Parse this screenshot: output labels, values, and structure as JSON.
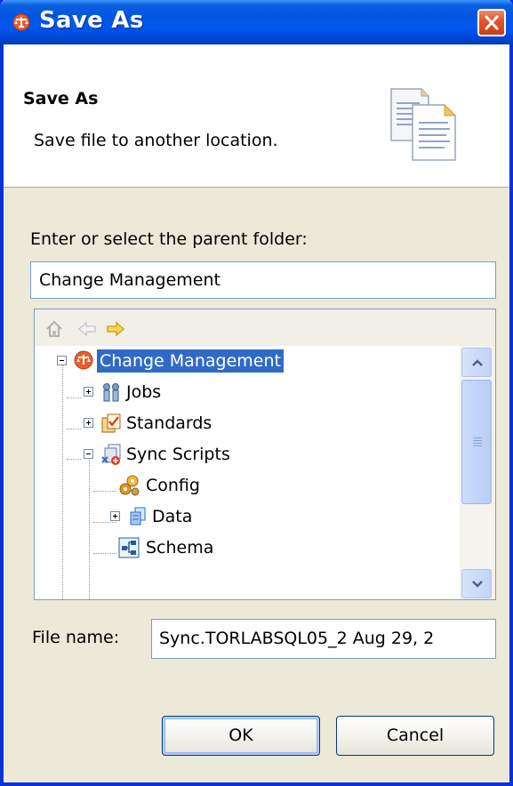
{
  "window": {
    "title": "Save As"
  },
  "banner": {
    "title": "Save As",
    "description": "Save file to another location."
  },
  "form": {
    "parent_label": "Enter or select the parent folder:",
    "parent_value": "Change Management",
    "filename_label": "File name:",
    "filename_value": "Sync.TORLABSQL05_2 Aug 29, 2"
  },
  "tree": {
    "items": [
      {
        "label": "Change Management",
        "level": 0,
        "expander": "minus",
        "selected": true,
        "icon": "project-icon"
      },
      {
        "label": "Jobs",
        "level": 1,
        "expander": "plus",
        "icon": "jobs-icon"
      },
      {
        "label": "Standards",
        "level": 1,
        "expander": "plus",
        "icon": "standards-icon"
      },
      {
        "label": "Sync Scripts",
        "level": 1,
        "expander": "minus",
        "icon": "sync-scripts-icon"
      },
      {
        "label": "Config",
        "level": 2,
        "expander": "none",
        "icon": "config-icon"
      },
      {
        "label": "Data",
        "level": 2,
        "expander": "plus",
        "icon": "data-icon"
      },
      {
        "label": "Schema",
        "level": 2,
        "expander": "none",
        "icon": "schema-icon"
      }
    ]
  },
  "buttons": {
    "ok": "OK",
    "cancel": "Cancel"
  },
  "colors": {
    "titlebar": "#0058ee",
    "selection": "#316ac5",
    "close": "#e2552f"
  }
}
